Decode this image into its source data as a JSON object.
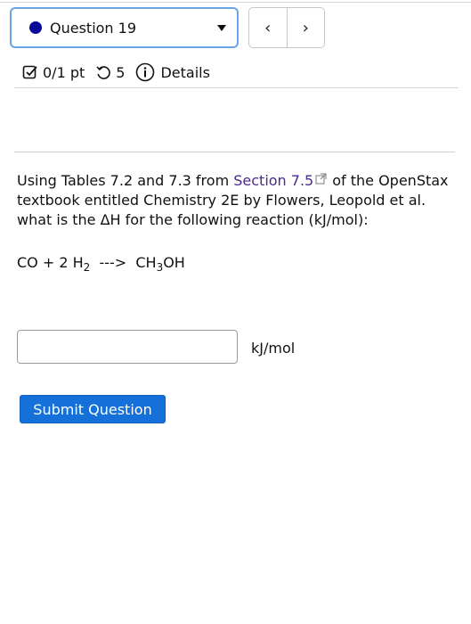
{
  "header": {
    "question_select_label": "Question 19",
    "prev_label": "‹",
    "next_label": "›"
  },
  "meta": {
    "score": "0/1 pt",
    "attempts": "5",
    "details_label": "Details"
  },
  "question": {
    "intro": "Using  Tables 7.2 and 7.3 from ",
    "link_text": "Section 7.5",
    "rest": "of the OpenStax textbook entitled Chemistry 2E by Flowers, Leopold et al. what is the ΔH for the following reaction (kJ/mol):",
    "equation": {
      "reactant1": "CO + 2 H",
      "reactant1_sub": "2",
      "arrow": "  --->  ",
      "product_pre": "CH",
      "product_sub": "3",
      "product_post": "OH"
    }
  },
  "answer": {
    "value": "",
    "unit": "kJ/mol"
  },
  "submit_label": "Submit Question",
  "colors": {
    "accent": "#1670d9",
    "link": "#4a2b8a",
    "status_dot": "#0a0a9a",
    "focus_border": "#6aa3e6"
  }
}
